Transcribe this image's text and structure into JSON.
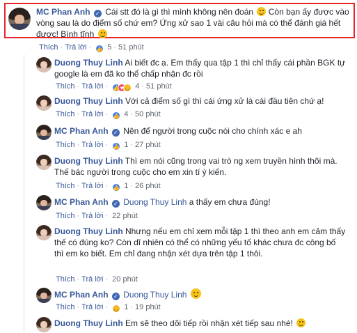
{
  "action_like": "Thích",
  "action_reply": "Trả lời",
  "comments": [
    {
      "author": "MC Phan Anh",
      "text": "Cái stt đó là gì thì mình không nên đoán",
      "text_after_emoji": "Còn bạn ấy được vào vòng sau là do điểm số chứ em? Ứng xử sao 1 vài câu hỏi mà có thể đánh giá hết được! Bình tĩnh",
      "reaction_count": "5",
      "time": "51 phút"
    },
    {
      "author": "Duong Thuy Linh",
      "text": "Ai biết đc ạ. Em thấy qua tập 1 thì chỉ thấy cái phần BGK tự google là em đã ko thể chấp nhận đc rồi",
      "reaction_count": "4",
      "time": "51 phút"
    },
    {
      "author": "Duong Thuy Linh",
      "text": "Với cả điểm số gì thì cái ứng xử là cái đầu tiên chứ ạ!",
      "reaction_count": "4",
      "time": "50 phút"
    },
    {
      "author": "MC Phan Anh",
      "text": "Nên để người trong cuộc nói cho chính xác e ah",
      "reaction_count": "1",
      "time": "27 phút"
    },
    {
      "author": "Duong Thuy Linh",
      "text": "Thì em nói cũng trong vai trò ng xem truyền hình thôi mà. Thế bác người trong cuộc cho em xin tí ý kiến.",
      "reaction_count": "1",
      "time": "26 phút"
    },
    {
      "author": "MC Phan Anh",
      "mention": "Duong Thuy Linh",
      "text": "a thấy em chưa đúng!",
      "time": "22 phút"
    },
    {
      "author": "Duong Thuy Linh",
      "text": "Nhưng nếu em chỉ xem mỗi tập 1 thì theo anh em cảm thấy thế có đúng ko? Còn dĩ nhiên có thể có những yếu tố khác chưa đc công bố thì em ko biết. Em chỉ đang nhận xét dựa trên tập 1 thôi.",
      "time": "20 phút"
    },
    {
      "author": "MC Phan Anh",
      "mention": "Duong Thuy Linh",
      "reaction_count": "1",
      "time": "19 phút"
    },
    {
      "author": "Duong Thuy Linh",
      "text": "Em sẽ theo dõi tiếp rồi nhận xét tiếp sau nhé!"
    }
  ],
  "colors": {
    "name_link": "#385898",
    "bubble_bg": "#f2f3f5",
    "highlight_border": "#e8262a",
    "meta_text": "#606770"
  }
}
